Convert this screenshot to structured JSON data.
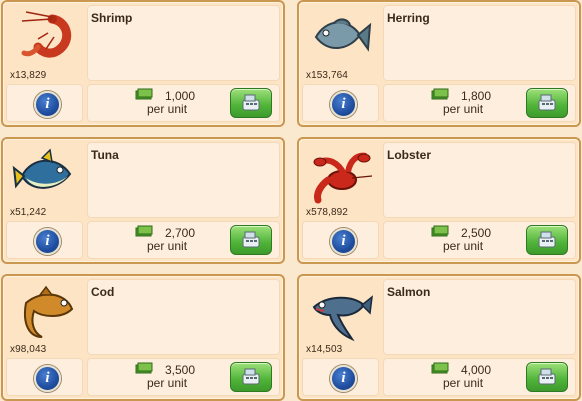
{
  "items": [
    {
      "name": "Shrimp",
      "count": "x13,829",
      "price": "1,000",
      "per": "per unit",
      "icon": "shrimp-icon",
      "color": "#c8391f"
    },
    {
      "name": "Herring",
      "count": "x153,764",
      "price": "1,800",
      "per": "per unit",
      "icon": "herring-icon",
      "color": "#6f8f9f"
    },
    {
      "name": "Tuna",
      "count": "x51,242",
      "price": "2,700",
      "per": "per unit",
      "icon": "tuna-icon",
      "color": "#2f6f9e"
    },
    {
      "name": "Lobster",
      "count": "x578,892",
      "price": "2,500",
      "per": "per unit",
      "icon": "lobster-icon",
      "color": "#c9281a"
    },
    {
      "name": "Cod",
      "count": "x98,043",
      "price": "3,500",
      "per": "per unit",
      "icon": "cod-icon",
      "color": "#d08a2a"
    },
    {
      "name": "Salmon",
      "count": "x14,503",
      "price": "4,000",
      "per": "per unit",
      "icon": "salmon-icon",
      "color": "#4f6f8f"
    }
  ],
  "info_label": "i"
}
